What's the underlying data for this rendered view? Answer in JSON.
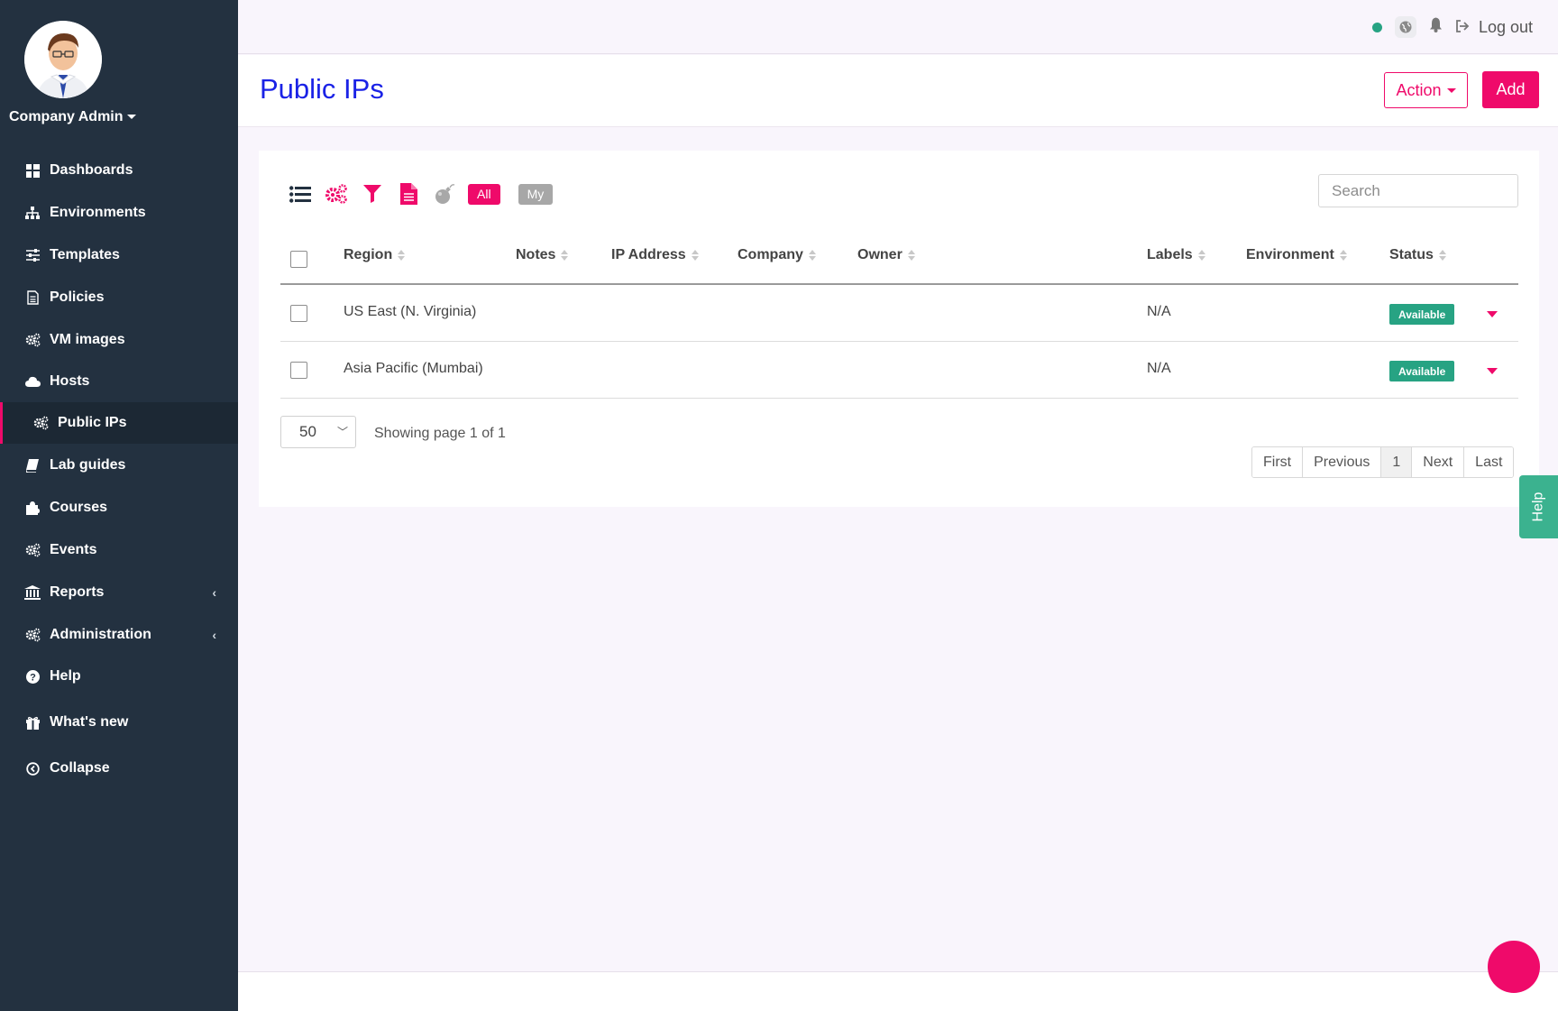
{
  "user": {
    "name": "Company Admin"
  },
  "nav": [
    {
      "label": "Dashboards",
      "icon": "dashboard-icon"
    },
    {
      "label": "Environments",
      "icon": "sitemap-icon"
    },
    {
      "label": "Templates",
      "icon": "sliders-icon"
    },
    {
      "label": "Policies",
      "icon": "document-icon"
    },
    {
      "label": "VM images",
      "icon": "cogs-icon"
    },
    {
      "label": "Hosts",
      "icon": "cloud-icon"
    },
    {
      "label": "Public IPs",
      "icon": "cogs-icon",
      "active": true
    },
    {
      "label": "Lab guides",
      "icon": "book-icon"
    },
    {
      "label": "Courses",
      "icon": "puzzle-icon"
    },
    {
      "label": "Events",
      "icon": "cogs-icon"
    },
    {
      "label": "Reports",
      "icon": "bank-icon",
      "chevron": "‹"
    },
    {
      "label": "Administration",
      "icon": "cogs-icon",
      "chevron": "‹"
    },
    {
      "label": "Help",
      "icon": "question-icon"
    },
    {
      "label": "What's new",
      "icon": "gift-icon"
    },
    {
      "label": "Collapse",
      "icon": "collapse-icon"
    }
  ],
  "topbar": {
    "logout": "Log out"
  },
  "page": {
    "title": "Public IPs",
    "action_label": "Action",
    "add_label": "Add"
  },
  "filters": {
    "all": "All",
    "my": "My"
  },
  "search": {
    "placeholder": "Search"
  },
  "table": {
    "columns": [
      "Region",
      "Notes",
      "IP Address",
      "Company",
      "Owner",
      "Labels",
      "Environment",
      "Status"
    ],
    "rows": [
      {
        "region": "US East (N. Virginia)",
        "labels": "N/A",
        "status": "Available"
      },
      {
        "region": "Asia Pacific (Mumbai)",
        "labels": "N/A",
        "status": "Available"
      }
    ]
  },
  "pagination": {
    "per_page": "50",
    "showing": "Showing page 1 of 1",
    "first": "First",
    "previous": "Previous",
    "current": "1",
    "next": "Next",
    "last": "Last"
  },
  "help_tab": "Help",
  "colors": {
    "accent": "#ef0a6a",
    "sidebar": "#233140",
    "title": "#1a22e6",
    "status": "#27a383"
  }
}
